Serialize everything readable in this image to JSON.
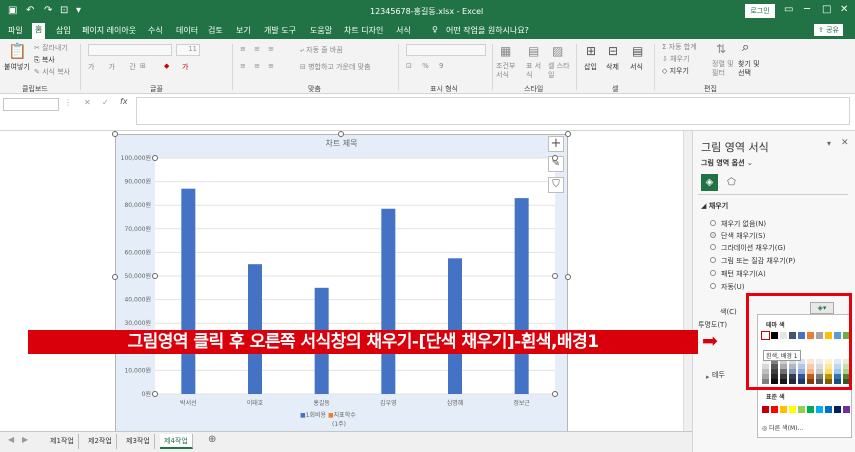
{
  "titlebar": {
    "title": "12345678-홍길동.xlsx - Excel",
    "search_placeholder": "어떤 작업을 원하시나요?",
    "login": "로그인"
  },
  "menu": {
    "items": [
      "파일",
      "홈",
      "삽입",
      "페이지 레이아웃",
      "수식",
      "데이터",
      "검토",
      "보기",
      "개발 도구",
      "도움말",
      "차트 디자인",
      "서식"
    ],
    "active_index": 1,
    "share": "공유"
  },
  "ribbon": {
    "clipboard": {
      "paste": "붙여넣기",
      "cut": "잘라내기",
      "copy": "복사",
      "format_painter": "서식 복사",
      "label": "클립보드"
    },
    "font": {
      "size": "11",
      "label": "글꼴"
    },
    "alignment": {
      "wrap": "자동 줄 바꿈",
      "merge": "병합하고 가운데 맞춤",
      "label": "맞춤"
    },
    "number": {
      "label": "표시 형식"
    },
    "styles": {
      "conditional": "조건부 서식",
      "table": "표 서식",
      "cell": "셀 스타일",
      "label": "스타일"
    },
    "cells": {
      "insert": "삽입",
      "delete": "삭제",
      "format": "서식",
      "label": "셀"
    },
    "editing": {
      "autosum": "자동 합계",
      "fill": "채우기",
      "clear": "지우기",
      "sort": "정렬 및 필터",
      "find": "찾기 및 선택",
      "label": "편집"
    }
  },
  "chart_data": {
    "type": "bar",
    "title": "차트 제목",
    "categories": [
      "박서선",
      "이태호",
      "홍길동",
      "김우영",
      "심명혜",
      "정보근"
    ],
    "series": [
      {
        "name": "1회비용",
        "values": [
          87000,
          55000,
          45000,
          78500,
          57500,
          83000
        ]
      }
    ],
    "second_legend": "지표학수",
    "legend_footer": "(1주)",
    "yticks": [
      "0원",
      "10,000원",
      "20,000원",
      "30,000원",
      "40,000원",
      "50,000원",
      "60,000원",
      "70,000원",
      "80,000원",
      "90,000원",
      "100,000원"
    ],
    "ylim": [
      0,
      100000
    ],
    "bar_color": "#4472c4"
  },
  "pane": {
    "title": "그림 영역 서식",
    "options": "그림 영역 옵션",
    "fill_section": "채우기",
    "fill_options": [
      "채우기 없음(N)",
      "단색 채우기(S)",
      "그라데이션 채우기(G)",
      "그림 또는 질감 채우기(P)",
      "패턴 채우기(A)",
      "자동(U)"
    ],
    "selected_fill": 1,
    "color_label": "색(C)",
    "transparency_label": "투명도(T)",
    "border_label": "테두"
  },
  "palette": {
    "theme_label": "테마 색",
    "tooltip": "흰색, 배경 1",
    "standard_label": "표준 색",
    "more_colors": "다른 색(M)..."
  },
  "banner": "그림영역 클릭 후 오른쪽 서식창의 채우기-[단색 채우기]-흰색,배경1",
  "sheets": [
    "제1작업",
    "제2작업",
    "제3작업",
    "제4작업"
  ],
  "active_sheet": 3
}
